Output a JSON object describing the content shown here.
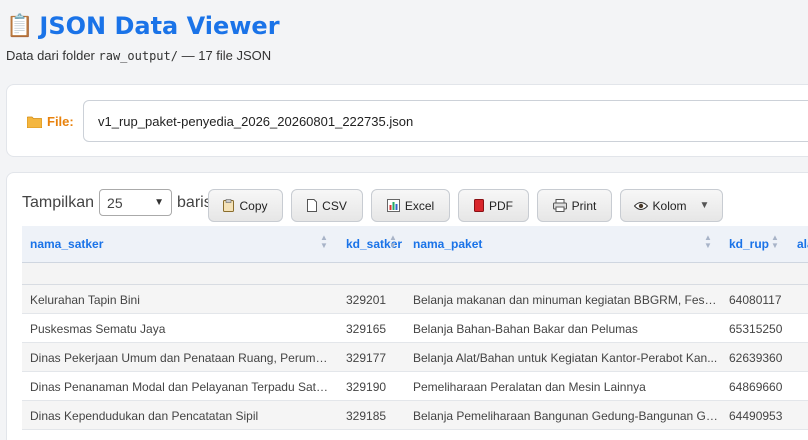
{
  "header": {
    "icon": "clipboard-icon",
    "title": "JSON Data Viewer",
    "subtitle_prefix": "Data dari folder ",
    "subtitle_folder": "raw_output/",
    "subtitle_suffix": " — 17 file JSON"
  },
  "file": {
    "label": "File:",
    "selected": "v1_rup_paket-penyedia_2026_20260801_222735.json"
  },
  "table_controls": {
    "show_label": "Tampilkan",
    "page_size": "25",
    "rows_label": "baris",
    "buttons": [
      "Copy",
      "CSV",
      "Excel",
      "PDF",
      "Print",
      "Kolom"
    ]
  },
  "table": {
    "columns": [
      "nama_satker",
      "kd_satker",
      "nama_paket",
      "kd_rup",
      "ala"
    ],
    "rows": [
      [
        "Kelurahan Tapin Bini",
        "329201",
        "Belanja makanan dan minuman kegiatan BBGRM, Festi...",
        "64080117"
      ],
      [
        "Puskesmas Sematu Jaya",
        "329165",
        "Belanja Bahan-Bahan Bakar dan Pelumas",
        "65315250"
      ],
      [
        "Dinas Pekerjaan Umum dan Penataan Ruang, Perumah...",
        "329177",
        "Belanja Alat/Bahan untuk Kegiatan Kantor-Perabot Kan...",
        "62639360"
      ],
      [
        "Dinas Penanaman Modal dan Pelayanan Terpadu Satu ...",
        "329190",
        "Pemeliharaan Peralatan dan Mesin Lainnya",
        "64869660"
      ],
      [
        "Dinas Kependudukan dan Pencatatan Sipil",
        "329185",
        "Belanja Pemeliharaan Bangunan Gedung-Bangunan Ge...",
        "64490953"
      ]
    ]
  },
  "colors": {
    "accent": "#1a73e8",
    "file_label": "#e8820c"
  }
}
